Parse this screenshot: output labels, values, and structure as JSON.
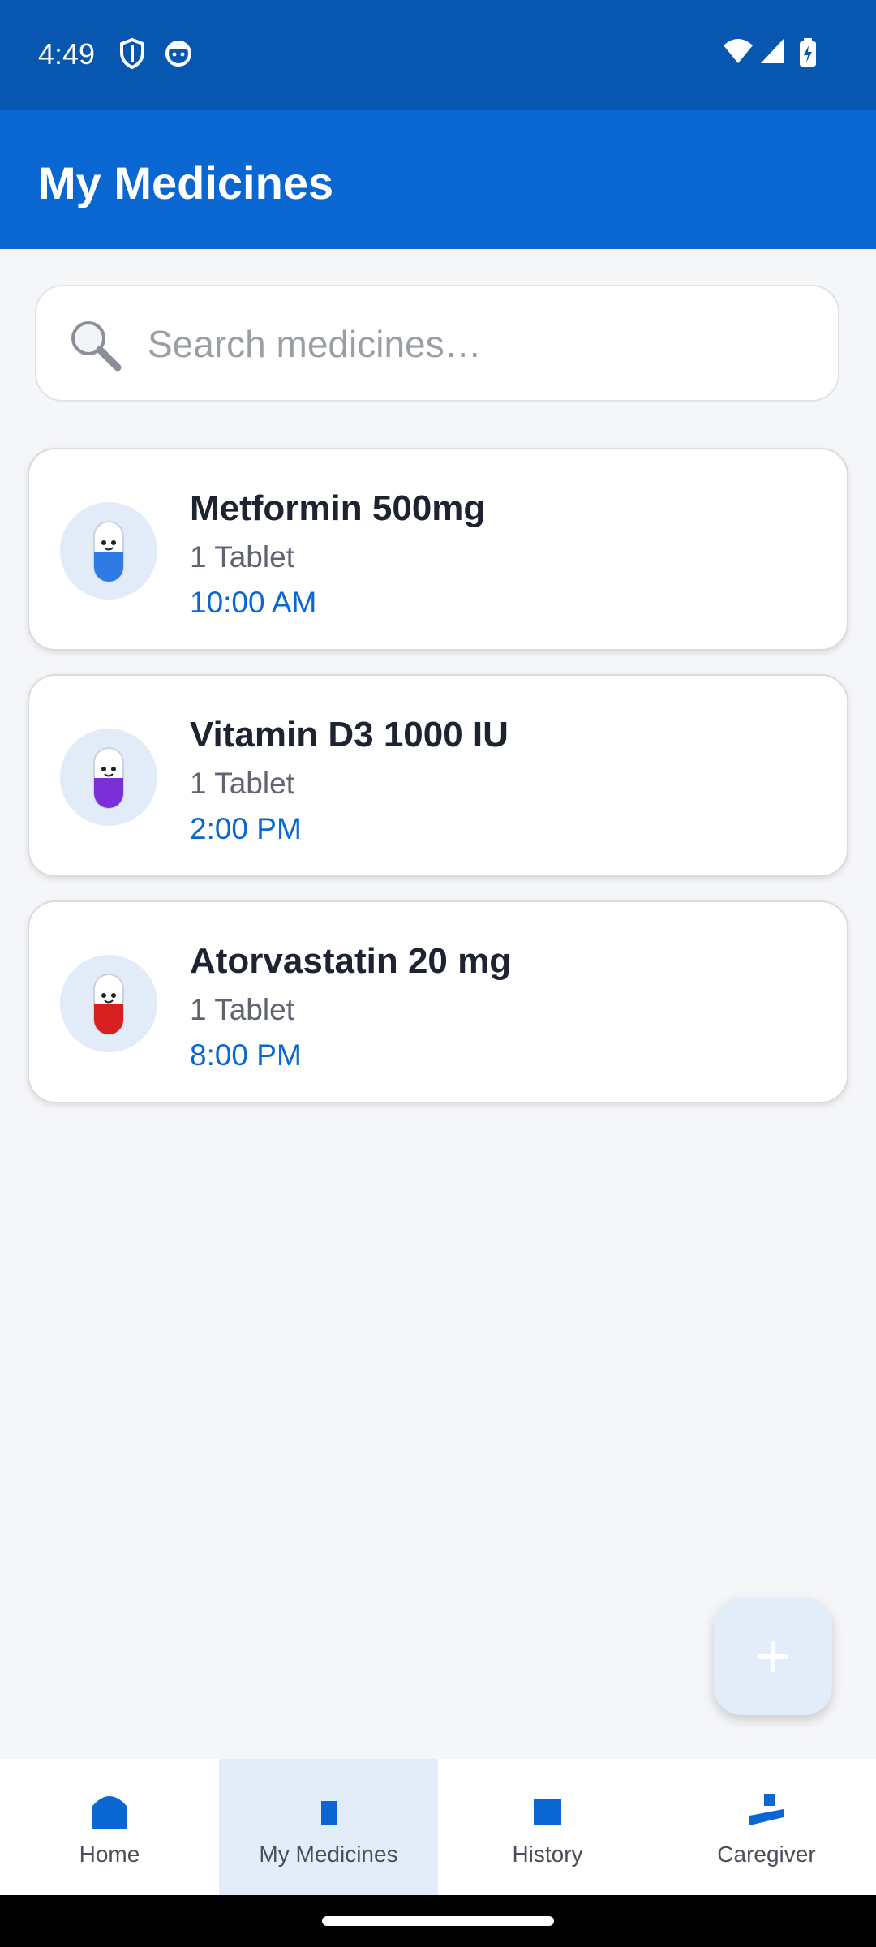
{
  "status_bar": {
    "time": "4:49",
    "icons": [
      "shield-icon",
      "face-icon",
      "wifi-icon",
      "signal-icon",
      "battery-charging-icon"
    ]
  },
  "app_bar": {
    "title": "My Medicines"
  },
  "search": {
    "placeholder": "Search medicines…",
    "value": ""
  },
  "medicines": [
    {
      "name": "Metformin 500mg",
      "dose": "1 Tablet",
      "time": "10:00 AM",
      "pill_color": "#2f7be6"
    },
    {
      "name": "Vitamin D3 1000 IU",
      "dose": "1 Tablet",
      "time": "2:00 PM",
      "pill_color": "#7b2fd6"
    },
    {
      "name": "Atorvastatin 20 mg",
      "dose": "1 Tablet",
      "time": "8:00 PM",
      "pill_color": "#d62020"
    }
  ],
  "fab": {
    "icon": "plus-icon"
  },
  "bottom_nav": {
    "items": [
      {
        "label": "Home",
        "icon": "home-icon"
      },
      {
        "label": "My Medicines",
        "icon": "medicine-icon",
        "active": true
      },
      {
        "label": "History",
        "icon": "history-icon"
      },
      {
        "label": "Caregiver",
        "icon": "caregiver-icon"
      }
    ]
  },
  "colors": {
    "primary": "#0a67d2",
    "status_bar": "#0757b0",
    "background": "#f5f6f8",
    "active_nav": "#e3ecf9"
  }
}
